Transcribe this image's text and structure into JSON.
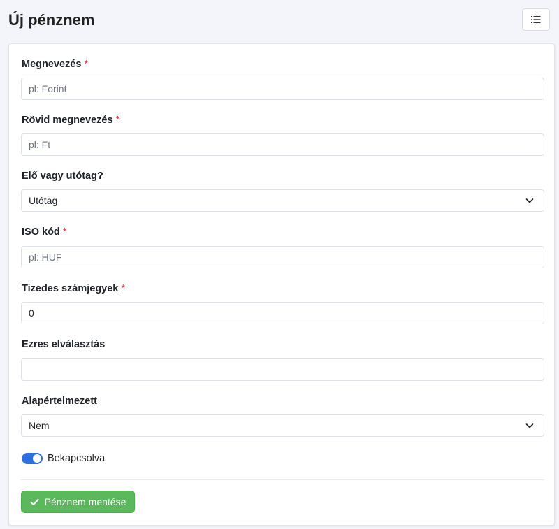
{
  "page": {
    "title": "Új pénznem"
  },
  "header": {
    "menu_icon": "list-icon"
  },
  "form": {
    "name": {
      "label": "Megnevezés",
      "required_mark": "*",
      "placeholder": "pl: Forint",
      "value": ""
    },
    "short_name": {
      "label": "Rövid megnevezés",
      "required_mark": "*",
      "placeholder": "pl: Ft",
      "value": ""
    },
    "position": {
      "label": "Elő vagy utótag?",
      "selected": "Utótag"
    },
    "iso_code": {
      "label": "ISO kód",
      "required_mark": "*",
      "placeholder": "pl: HUF",
      "value": ""
    },
    "decimals": {
      "label": "Tizedes számjegyek",
      "required_mark": "*",
      "value": "0"
    },
    "thousands_sep": {
      "label": "Ezres elválasztás",
      "value": ""
    },
    "default": {
      "label": "Alapértelmezett",
      "selected": "Nem"
    },
    "enabled": {
      "label": "Bekapcsolva",
      "checked": true
    },
    "save_label": "Pénznem mentése"
  },
  "colors": {
    "accent": "#2e6fe0",
    "success": "#5cb85c",
    "required": "#dc3545",
    "background": "#f4f5fa"
  }
}
